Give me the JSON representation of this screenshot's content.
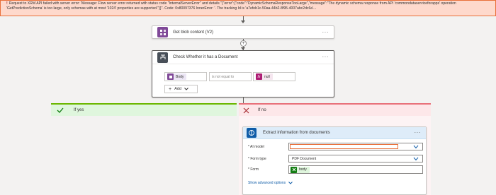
{
  "error": {
    "message": "Request to XRM API failed with server error: 'Message: Flow server error returned with status code \"InternalServerError\" and details \"{\"error\":{\"code\":\"DynamicSchemaResponseTooLarge\",\"message\":\"The dynamic schema response from API 'commondataserviceforapps' operation 'GetPredictionSchema' is too large, only schemas with at most '1024' properties are supported.\"}}\". Code: 0x80097376 InnerError: '. The tracking Id is 'a7efeb1c-50aa-44b2-8f95-4007abc2dc6a'..."
  },
  "blob_action": {
    "title": "Get blob content (V2)",
    "menu": "···",
    "icon": "azure-blob-icon",
    "color": "#804998"
  },
  "condition": {
    "title": "Check Whether it has a Document",
    "menu": "···",
    "icon": "condition-icon",
    "color": "#484f58",
    "left_token": "Body",
    "operator": "is not equal to",
    "right_token": "null",
    "add_label": "Add"
  },
  "branch_yes": {
    "label": "If yes",
    "color": "#dff6dd"
  },
  "branch_no": {
    "label": "If no",
    "color": "#fde7e9"
  },
  "ai_action": {
    "title": "Extract information from documents",
    "menu": "···",
    "icon": "ai-builder-icon",
    "color": "#0f5ca8",
    "fields": {
      "ai_model_label": "* AI model",
      "ai_model_value": "",
      "form_type_label": "* Form type",
      "form_type_value": "PDF Document",
      "form_label": "* Form",
      "form_token": "body"
    },
    "show_advanced": "Show advanced options"
  }
}
